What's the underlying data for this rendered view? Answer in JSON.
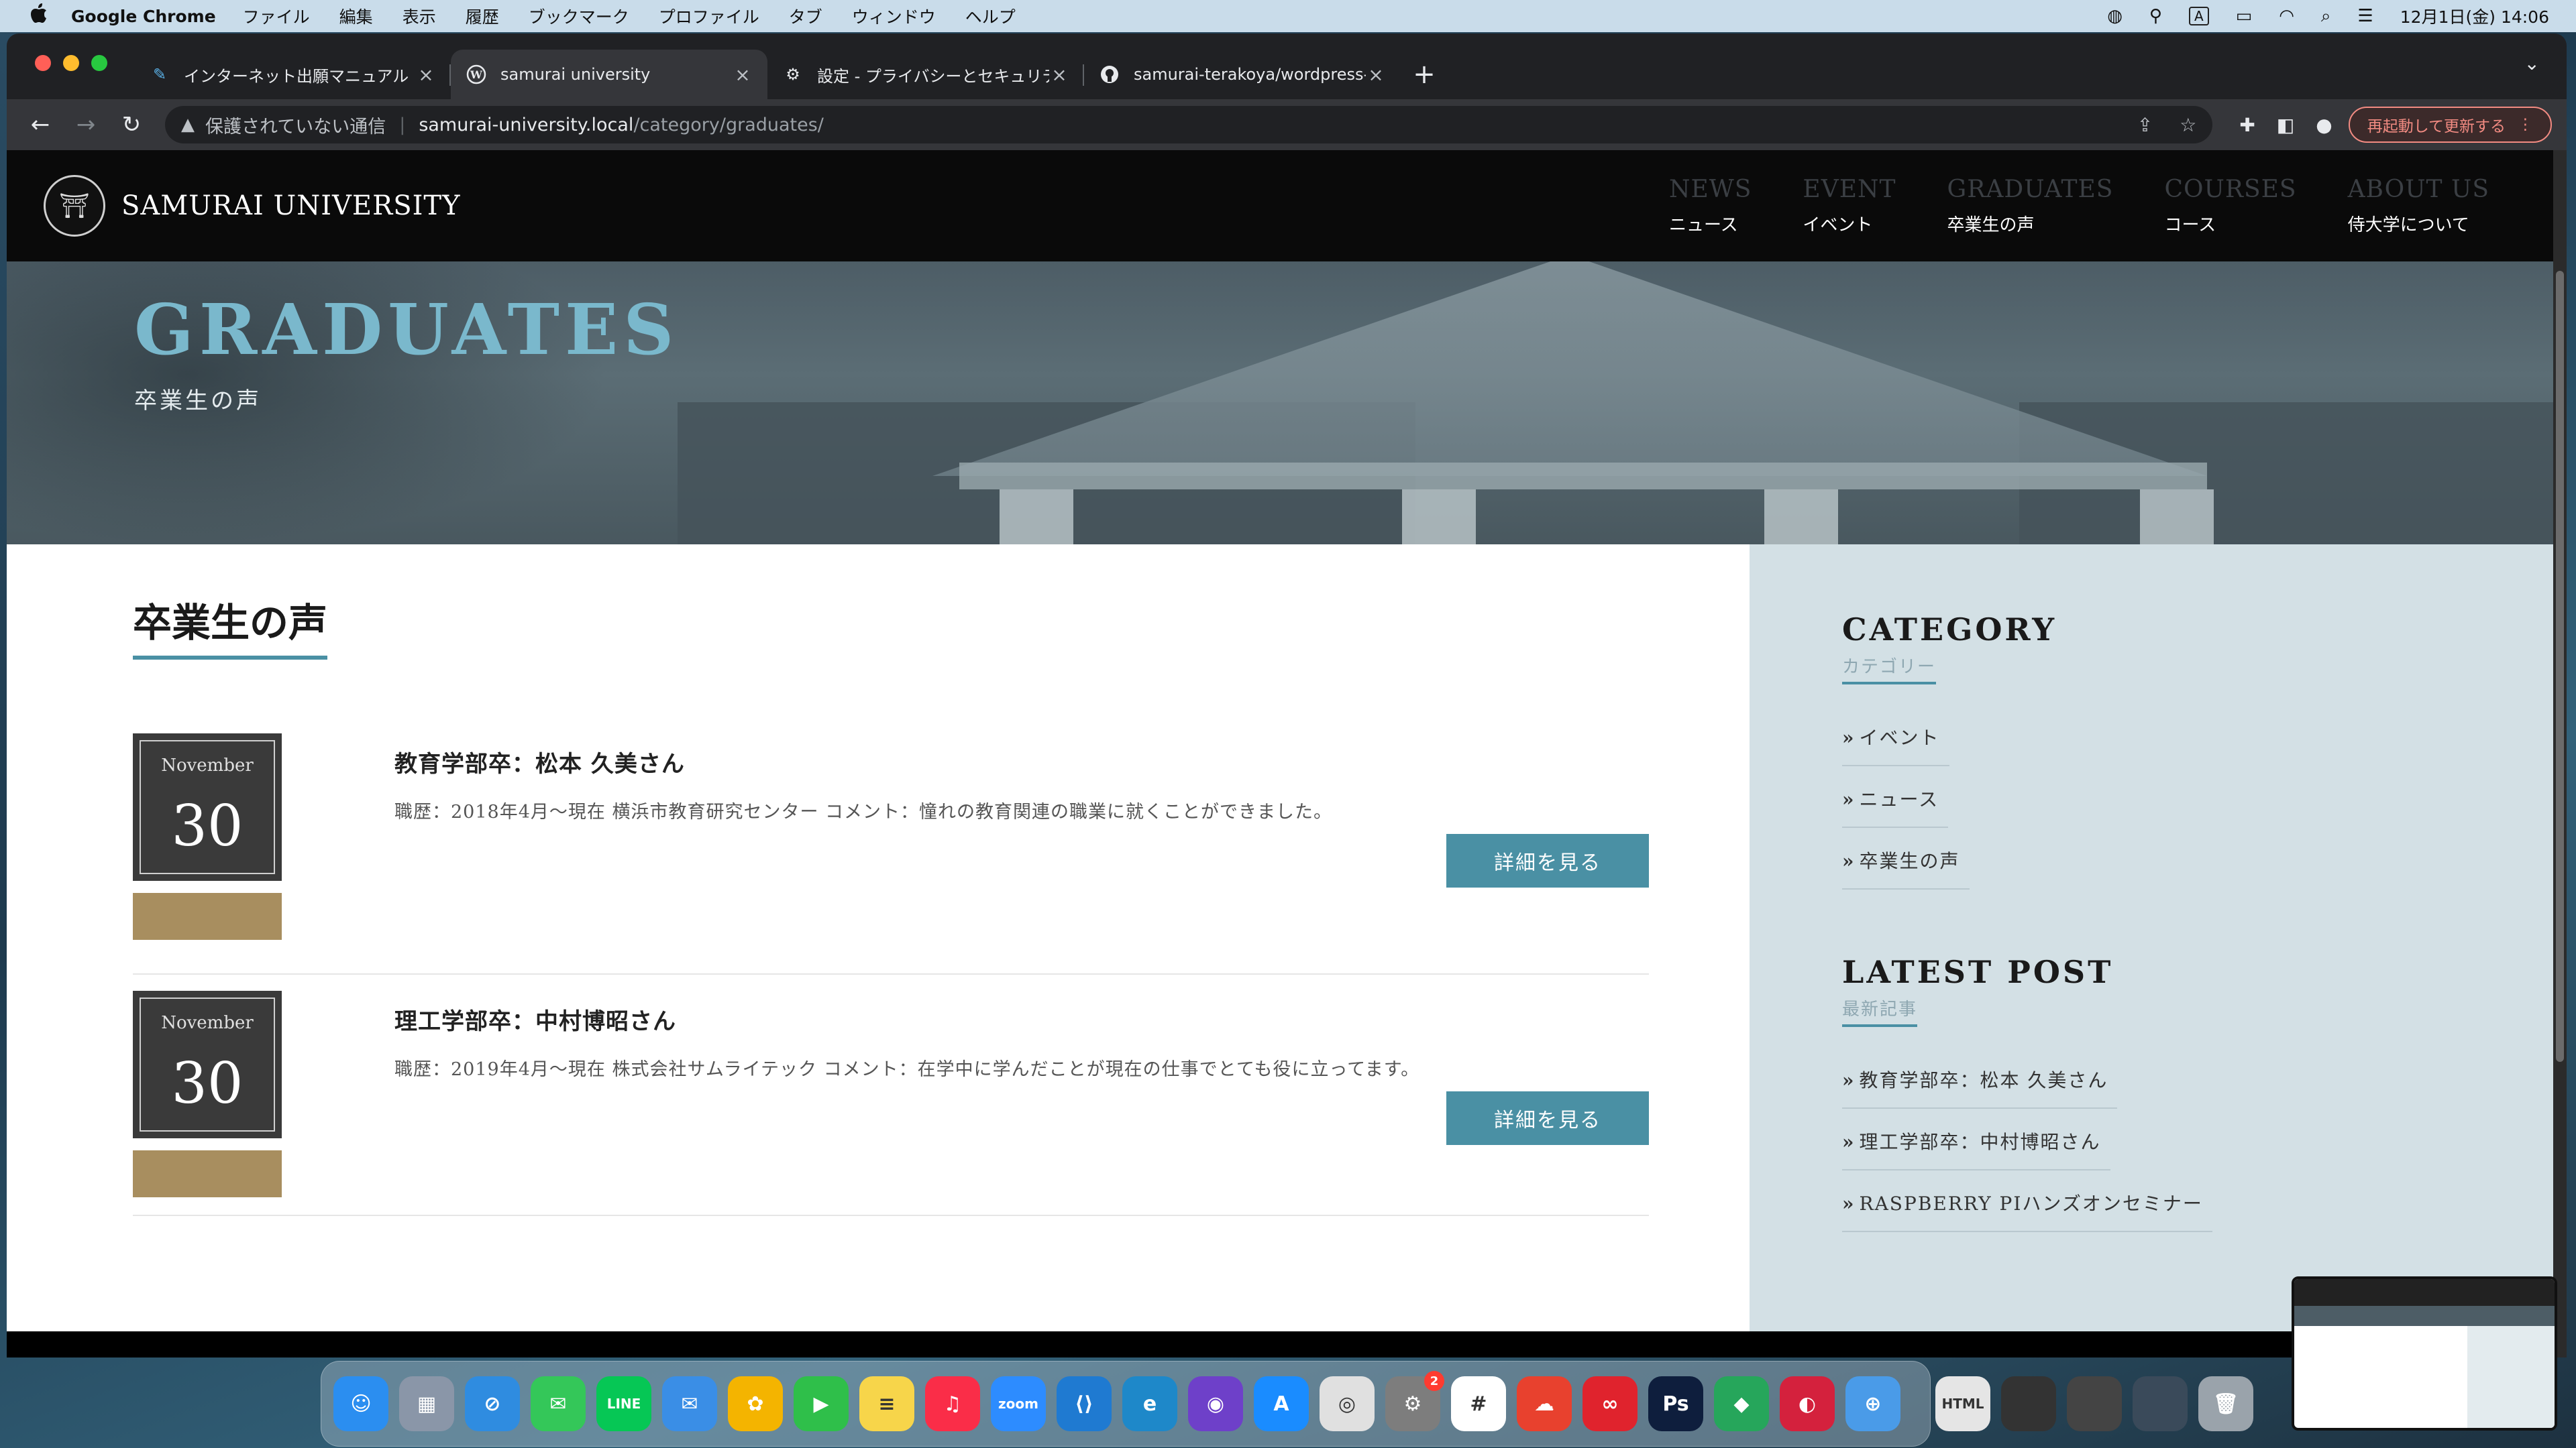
{
  "menubar": {
    "apple": "",
    "app_name": "Google Chrome",
    "items": [
      "ファイル",
      "編集",
      "表示",
      "履歴",
      "ブックマーク",
      "プロファイル",
      "タブ",
      "ウィンドウ",
      "ヘルプ"
    ],
    "input_mode": "A",
    "clock": "12月1日(金)  14:06"
  },
  "browser": {
    "tabs": [
      {
        "title": "インターネット出願マニュアル",
        "icon": "feather-icon",
        "active": false
      },
      {
        "title": "samurai university",
        "icon": "wordpress-icon",
        "active": true
      },
      {
        "title": "設定 - プライバシーとセキュリテ",
        "icon": "gear-icon",
        "active": false
      },
      {
        "title": "samurai-terakoya/wordpress-",
        "icon": "github-icon",
        "active": false
      }
    ],
    "address": {
      "security_label": "保護されていない通信",
      "domain": "samurai-university.local",
      "path": "/category/graduates/"
    },
    "update_button": "再起動して更新する"
  },
  "site": {
    "logo_text": "SAMURAI UNIVERSITY",
    "nav": [
      {
        "en": "NEWS",
        "ja": "ニュース"
      },
      {
        "en": "EVENT",
        "ja": "イベント"
      },
      {
        "en": "GRADUATES",
        "ja": "卒業生の声"
      },
      {
        "en": "COURSES",
        "ja": "コース"
      },
      {
        "en": "ABOUT US",
        "ja": "侍大学について"
      }
    ],
    "hero": {
      "title": "GRADUATES",
      "subtitle": "卒業生の声"
    },
    "section_title": "卒業生の声",
    "posts": [
      {
        "month": "November",
        "day": "30",
        "title": "教育学部卒：松本 久美さん",
        "excerpt": "職歴：2018年4月～現在 横浜市教育研究センター コメント：憧れの教育関連の職業に就くことができました。",
        "button": "詳細を見る"
      },
      {
        "month": "November",
        "day": "30",
        "title": "理工学部卒：中村博昭さん",
        "excerpt": "職歴：2019年4月～現在 株式会社サムライテック コメント：在学中に学んだことが現在の仕事でとても役に立ってます。",
        "button": "詳細を見る"
      }
    ],
    "sidebar": {
      "category": {
        "title": "CATEGORY",
        "subtitle": "カテゴリー",
        "links": [
          "イベント",
          "ニュース",
          "卒業生の声"
        ]
      },
      "latest": {
        "title": "LATEST POST",
        "subtitle": "最新記事",
        "links": [
          "教育学部卒：松本 久美さん",
          "理工学部卒：中村博昭さん",
          "RASPBERRY PIハンズオンセミナー"
        ]
      }
    },
    "colors": {
      "accent": "#4a90a4",
      "tag": "#a88e5f",
      "sidebar_bg": "#d3e0e5"
    }
  },
  "dock": {
    "apps": [
      {
        "name": "finder",
        "label": "☺",
        "color": "#2b8ef0"
      },
      {
        "name": "launchpad",
        "label": "▦",
        "color": "#8a96a8"
      },
      {
        "name": "safari",
        "label": "⊘",
        "color": "#2f8ce0"
      },
      {
        "name": "messages",
        "label": "✉",
        "color": "#34c759"
      },
      {
        "name": "line",
        "label": "LINE",
        "color": "#06c755"
      },
      {
        "name": "mail",
        "label": "✉",
        "color": "#3a8ee6"
      },
      {
        "name": "photos",
        "label": "✿",
        "color": "#f4b400"
      },
      {
        "name": "facetime",
        "label": "▶",
        "color": "#2fbf4a"
      },
      {
        "name": "notes",
        "label": "≡",
        "color": "#f7d54a"
      },
      {
        "name": "music",
        "label": "♫",
        "color": "#fa2d48"
      },
      {
        "name": "zoom",
        "label": "zoom",
        "color": "#2d8cff"
      },
      {
        "name": "vscode",
        "label": "⟨⟩",
        "color": "#1f7ad1"
      },
      {
        "name": "edge",
        "label": "e",
        "color": "#1e88c9"
      },
      {
        "name": "github-desktop",
        "label": "◉",
        "color": "#6e40c9"
      },
      {
        "name": "app-store",
        "label": "A",
        "color": "#1a8cff"
      },
      {
        "name": "chrome",
        "label": "◎",
        "color": "#e0e0e0"
      },
      {
        "name": "system-settings",
        "label": "⚙",
        "color": "#7d7d7d",
        "badge": "2"
      },
      {
        "name": "slack",
        "label": "#",
        "color": "#ffffff"
      },
      {
        "name": "adobe-cc",
        "label": "☁",
        "color": "#e8412e"
      },
      {
        "name": "creative-cloud",
        "label": "∞",
        "color": "#e0232d"
      },
      {
        "name": "photoshop",
        "label": "Ps",
        "color": "#0e1e3d"
      },
      {
        "name": "sourcetree",
        "label": "◆",
        "color": "#26a65b"
      },
      {
        "name": "app-red",
        "label": "◐",
        "color": "#d4213d"
      },
      {
        "name": "preview",
        "label": "⊕",
        "color": "#4a9be8"
      }
    ],
    "recent": [
      {
        "name": "html-file",
        "label": "HTML",
        "color": "#e5e5e5"
      },
      {
        "name": "screenshot-1",
        "label": "",
        "color": "#333"
      },
      {
        "name": "screenshot-2",
        "label": "",
        "color": "#444"
      },
      {
        "name": "screenshot-3",
        "label": "",
        "color": "#3a4a5a"
      },
      {
        "name": "trash",
        "label": "🗑",
        "color": "#9aa3ab"
      }
    ]
  }
}
